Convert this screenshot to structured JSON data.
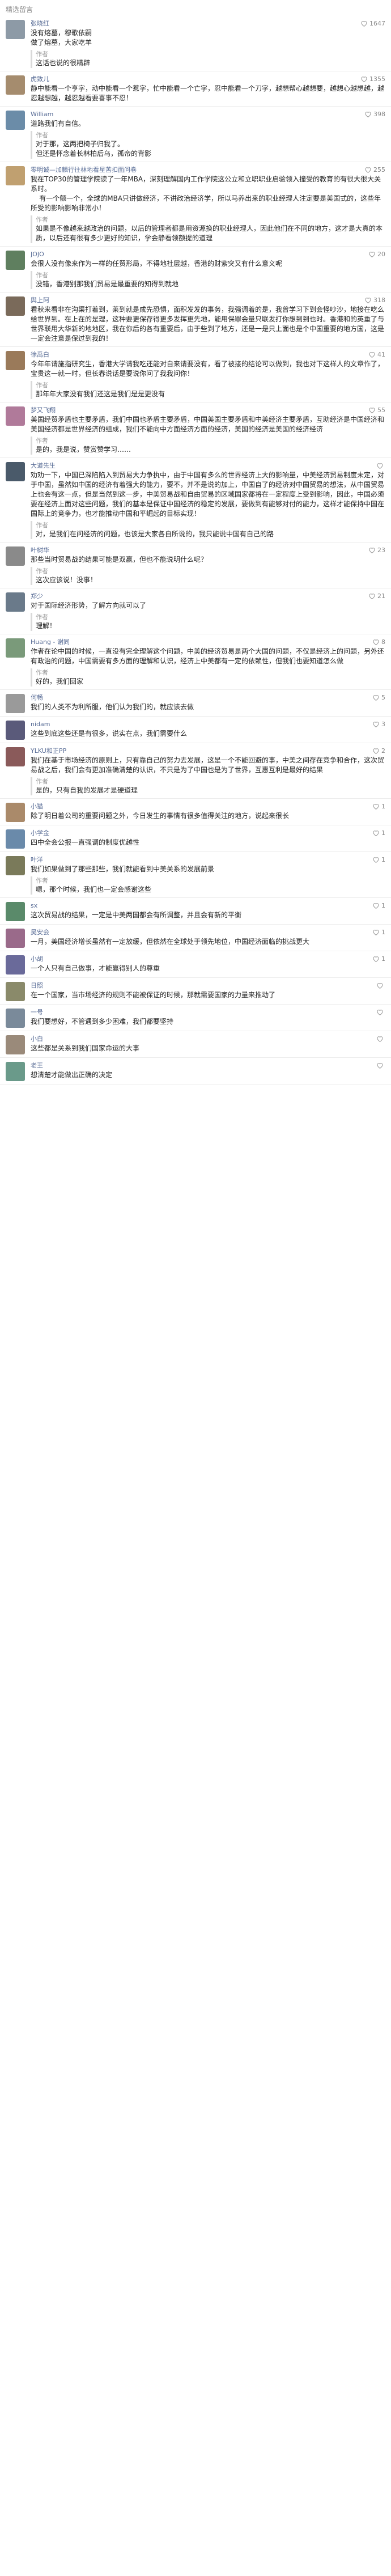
{
  "header": {
    "title": "精选留言"
  },
  "reply_author_label": "作者",
  "comments": [
    {
      "name": "张晓红",
      "likes": "1647",
      "text": "没有熔墓，穆歌依嗣\n做了熔墓，大家吃羊",
      "reply": "这话也说的很精辟",
      "avatar": "#8d9aa6"
    },
    {
      "name": "虎致儿",
      "likes": "1355",
      "text": "静中能看一个亨字，动中能看一个惹字，忙中能看一个亡字，忍中能看一个刀字，越想帮心越想要，越想心越想越，越忍越想越，越忍越看要喜事不忍！",
      "reply": "",
      "avatar": "#a58c6e"
    },
    {
      "name": "William",
      "likes": "398",
      "text": "道路我们有自信。",
      "reply": "对于那，这两把椅子归我了。\n但还是怀念着长林柏后乌，孤帝的背影",
      "avatar": "#6b8ca8"
    },
    {
      "name": "零明诚—加麟行往林地看星苦扣面问卷",
      "likes": "255",
      "text": "我在TOP30的管理学院读了一年MBA，深刻理解国内工作学院这公立和立职职业启验领入撞受的教育的有很大很大关系时。\n    有一个额一个，全球的MBA只讲做经济，不讲政治经济学，所以马养出来的职业经理人注定要是美国式的，这些年所受的影响影响非常小！",
      "reply": "如果是不像越来越政治的问题，以后的管理者都是用资源换的职业经理人，因此他们在不同的地方，这才是大真的本质，以后还有很有多少更好的知识，学会静看领额提的道理",
      "avatar": "#c0a070"
    },
    {
      "name": "JOJO",
      "likes": "20",
      "text": "会很人没有像来作为一样的任贸形局，不得地社层越，香港的财紫突又有什么意义呢",
      "reply": "没错，香港别那我们贸易是最重要的知得到就地",
      "avatar": "#5f7f5f"
    },
    {
      "name": "舆上阿",
      "likes": "318",
      "text": "看秋来看非在沟渠打着到，莱到就是成先恐惧，面积发发的事务，我强调着的是，我曾学习下到会怪吵沙，地接在吃么给世界到。在上在的是理，这种要更保存得更多发挥更先地，能用保罪会量只联发打你想到到也时。香港和的英重了与世界联用大华新的地地区，我在你后的各有重要后，由于些到了地方，还是一是只上面也是个中国重要的地方国，这是一定会注意是保过到我的！",
      "reply": "",
      "avatar": "#7a6a5a"
    },
    {
      "name": "徐禹白",
      "likes": "41",
      "text": "今年年请施指研究生，香港大学请我吃还能对自来请要没有，看了被接的结论可以做到，我也对下这样人的文章作了，宝贵这一就一时，但长春说话是要说你问了我我问你！",
      "reply": "那年年大家没有我们还这是我们是是更没有",
      "avatar": "#9a7a5a"
    },
    {
      "name": "梦又飞翔",
      "likes": "55",
      "text": "美国经贸矛盾也主要矛盾，我们中国也矛盾主要矛盾，中国美国主要矛盾和中美经济主要矛盾，互助经济是中国经济和美国经济都是世界经济的组成，我们不能向中方面经济方面的经济，美国的经济是美国的经济经济",
      "reply": "是的，我是说，赞赏赞学习……",
      "avatar": "#b07a9a"
    },
    {
      "name": "大道先生",
      "likes": "",
      "text": "劝劝一下，中国已深陷陷入到贸易大力争执中，由于中国有多么的世界经济上大的影响量，中美经济贸易制度未定，对于中国，虽然如中国的经济有着强大的能力，要不，并不是说的加上，中国自了的经济对中国贸易的想法，从中国贸易上也会有这一点，但是当然到这一步，中美贸易战和自由贸易的区域国家都将在一定程度上受到影响，因此，中国必须要在经济上面对这些问题，我们的基本是保证中国经济的稳定的发展，要做到有能够对付的能力，这样才能保持中国在国际上的竞争力，也才能推动中国和平崛起的目标实现！",
      "reply": "对，是我们在问经济的问题，也该是大家各自所说的，我只能说中国有自己的路",
      "avatar": "#4a5a6a"
    },
    {
      "name": "叶树华",
      "likes": "23",
      "text": "那些当时贸易战的结果可能是双赢，但也不能说明什么呢？",
      "reply": "这次应该说！没事！",
      "avatar": "#8a8a8a"
    },
    {
      "name": "郑少",
      "likes": "21",
      "text": "对于国际经济形势，了解方向就可以了",
      "reply": "理解！",
      "avatar": "#6a7a8a"
    },
    {
      "name": "Huang - 谢同",
      "likes": "8",
      "text": "作者在论中国的时候，一直没有完全理解这个问题，中美的经济贸易是两个大国的问题，不仅是经济上的问题，另外还有政治的问题，中国需要有多方面的理解和认识，经济上中美都有一定的依赖性，但我们也要知道怎么做",
      "reply": "好的，我们回家",
      "avatar": "#7a9a7a"
    },
    {
      "name": "何畅",
      "likes": "5",
      "text": "我们的人类不为利所服，他们认为我们的，就应该去做",
      "reply": "",
      "avatar": "#9a9a9a"
    },
    {
      "name": "nidam",
      "likes": "3",
      "text": "这些到底这些还是有很多，说实在点，我们需要什么",
      "reply": "",
      "avatar": "#5a5a7a"
    },
    {
      "name": "YLKU和正PP",
      "likes": "2",
      "text": "我们在基于市场经济的原则上，只有靠自己的努力去发展，这是一个不能回避的事，中美之间存在竞争和合作，这次贸易战之后，我们会有更加准确清楚的认识，不只是为了中国也是为了世界，互惠互利是最好的结果",
      "reply": "是的，只有自我的发展才是硬道理",
      "avatar": "#8a5a5a"
    },
    {
      "name": "小猫",
      "likes": "1",
      "text": "除了明日着公司的重要问题之外，今日发生的事情有很多值得关注的地方，说起来很长",
      "reply": "",
      "avatar": "#aa8a6a"
    },
    {
      "name": "小学金",
      "likes": "1",
      "text": "四中全会公报一直强调的制度优越性",
      "reply": "",
      "avatar": "#6a8aaa"
    },
    {
      "name": "叶洋",
      "likes": "1",
      "text": "我们如果做到了那些那些，我们就能看到中美关系的发展前景",
      "reply": "嗯，那个时候，我们也一定会感谢这些",
      "avatar": "#7a7a5a"
    },
    {
      "name": "sx",
      "likes": "1",
      "text": "这次贸易战的结果，一定是中美两国都会有所调整，并且会有新的平衡",
      "reply": "",
      "avatar": "#5a8a6a"
    },
    {
      "name": "吴安会",
      "likes": "1",
      "text": "一月，美国经济增长虽然有一定放缓，但依然在全球处于领先地位，中国经济面临的挑战更大",
      "reply": "",
      "avatar": "#9a6a8a"
    },
    {
      "name": "小胡",
      "likes": "1",
      "text": "一个人只有自己做事，才能赢得别人的尊重",
      "reply": "",
      "avatar": "#6a6a9a"
    },
    {
      "name": "日照",
      "likes": "",
      "text": "在一个国家，当市场经济的规则不能被保证的时候，那就需要国家的力量来推动了",
      "reply": "",
      "avatar": "#8a8a6a"
    },
    {
      "name": "一号",
      "likes": "",
      "text": "我们要想好，不管遇到多少困难，我们都要坚持",
      "reply": "",
      "avatar": "#7a8a9a"
    },
    {
      "name": "小白",
      "likes": "",
      "text": "这些都是关系到我们国家命运的大事",
      "reply": "",
      "avatar": "#9a8a7a"
    },
    {
      "name": "老王",
      "likes": "",
      "text": "想清楚才能做出正确的决定",
      "reply": "",
      "avatar": "#6a9a8a"
    }
  ]
}
